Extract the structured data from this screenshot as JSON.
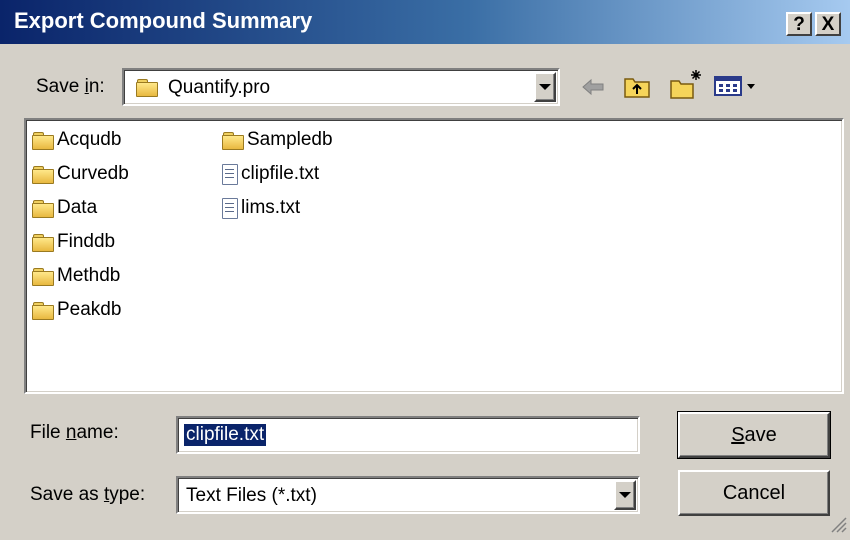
{
  "window": {
    "title": "Export Compound Summary",
    "help_label": "?",
    "close_label": "X"
  },
  "save_in": {
    "label_pre": "Save ",
    "label_accel": "i",
    "label_post": "n:",
    "value": "Quantify.pro"
  },
  "toolbar": {
    "back_icon": "back-arrow-icon",
    "up_icon": "up-folder-icon",
    "new_folder_icon": "new-folder-icon",
    "view_menu_icon": "view-menu-icon"
  },
  "files": {
    "column1": [
      {
        "name": "Acqudb",
        "kind": "folder"
      },
      {
        "name": "Curvedb",
        "kind": "folder"
      },
      {
        "name": "Data",
        "kind": "folder"
      },
      {
        "name": "Finddb",
        "kind": "folder"
      },
      {
        "name": "Methdb",
        "kind": "folder"
      },
      {
        "name": "Peakdb",
        "kind": "folder"
      }
    ],
    "column2": [
      {
        "name": "Sampledb",
        "kind": "folder"
      },
      {
        "name": "clipfile.txt",
        "kind": "text-file"
      },
      {
        "name": "lims.txt",
        "kind": "text-file"
      }
    ]
  },
  "file_name": {
    "label_pre": "File ",
    "label_accel": "n",
    "label_post": "ame:",
    "value": "clipfile.txt"
  },
  "save_as_type": {
    "label_pre": "Save as ",
    "label_accel": "t",
    "label_post": "ype:",
    "value": "Text Files (*.txt)"
  },
  "buttons": {
    "save_accel": "S",
    "save_rest": "ave",
    "cancel": "Cancel"
  },
  "colors": {
    "title_start": "#0a246a",
    "title_end": "#a6caf0",
    "dialog_bg": "#d4d0c8",
    "selection": "#0a246a"
  }
}
